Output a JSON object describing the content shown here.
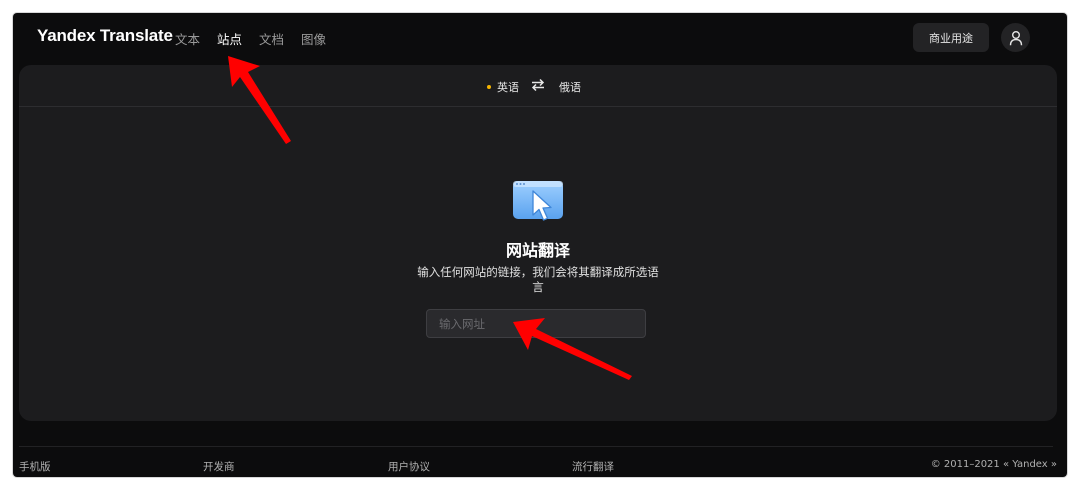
{
  "app": {
    "logo": "Yandex Translate"
  },
  "nav": {
    "items": [
      {
        "label": "文本",
        "active": false
      },
      {
        "label": "站点",
        "active": true
      },
      {
        "label": "文档",
        "active": false
      },
      {
        "label": "图像",
        "active": false
      }
    ]
  },
  "header": {
    "business_label": "商业用途",
    "avatar_icon": "user-icon"
  },
  "languages": {
    "source": "英语",
    "target": "俄语",
    "swap_icon": "swap-arrows-icon"
  },
  "site_translate": {
    "icon": "browser-cursor-icon",
    "title": "网站翻译",
    "description": "输入任何网站的链接，我们会将其翻译成所选语言",
    "input_value": "",
    "input_placeholder": "输入网址"
  },
  "footer": {
    "links": [
      "手机版",
      "开发商",
      "用户协议",
      "流行翻译"
    ],
    "copyright": "© 2011–2021 « Yandex »"
  },
  "colors": {
    "window_bg": "#0c0c0d",
    "card_bg": "#1c1c1e",
    "accent_dot": "#f5b400",
    "annotation_arrow": "#ff0000"
  }
}
